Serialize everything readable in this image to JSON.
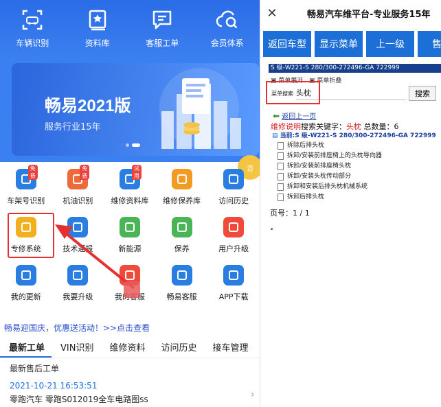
{
  "left": {
    "top_nav": [
      {
        "label": "车辆识别",
        "icon": "car-scan-icon"
      },
      {
        "label": "资料库",
        "icon": "book-icon"
      },
      {
        "label": "客服工单",
        "icon": "chat-icon"
      },
      {
        "label": "会员体系",
        "icon": "cloud-search-icon"
      }
    ],
    "banner": {
      "title": "畅易2021版",
      "subtitle": "服务行业15年"
    },
    "float_button": "咨",
    "grid_rows": [
      [
        {
          "label": "车架号识别",
          "icon": "vin-car-icon",
          "badge": "免费",
          "color": "#2a7de1"
        },
        {
          "label": "机油识别",
          "icon": "oil-icon",
          "badge": "免费",
          "color": "#ef6a3a"
        },
        {
          "label": "维修资料库",
          "icon": "repair-doc-icon",
          "badge": "试用",
          "color": "#2a7de1"
        },
        {
          "label": "维修保养库",
          "icon": "maintenance-icon",
          "badge": "",
          "color": "#f29a22"
        },
        {
          "label": "访问历史",
          "icon": "history-icon",
          "badge": "",
          "color": "#2a7de1"
        }
      ],
      [
        {
          "label": "专修系统",
          "icon": "clipboard-icon",
          "badge": "",
          "color": "#f2b01d"
        },
        {
          "label": "技术通报",
          "icon": "tech-bulletin-icon",
          "badge": "",
          "color": "#2a7de1"
        },
        {
          "label": "新能源",
          "icon": "leaf-icon",
          "badge": "",
          "color": "#4ab556"
        },
        {
          "label": "保养",
          "icon": "power-icon",
          "badge": "",
          "color": "#4ab556"
        },
        {
          "label": "用户升级",
          "icon": "upgrade-icon",
          "badge": "",
          "color": "#ef4a3a"
        }
      ],
      [
        {
          "label": "我的更新",
          "icon": "refresh-icon",
          "badge": "",
          "color": "#2a7de1"
        },
        {
          "label": "我要升级",
          "icon": "user-icon",
          "badge": "",
          "color": "#2a7de1"
        },
        {
          "label": "我的客服",
          "icon": "service-icon",
          "badge": "",
          "color": "#ef4a3a"
        },
        {
          "label": "畅易客服",
          "icon": "message-icon",
          "badge": "",
          "color": "#2a7de1"
        },
        {
          "label": "APP下载",
          "icon": "download-icon",
          "badge": "",
          "color": "#2a7de1"
        }
      ]
    ],
    "ticker": "畅易迎国庆，优惠送活动！>>点击查看",
    "tabs": [
      "最新工单",
      "VIN识别",
      "维修资料",
      "访问历史",
      "接车管理"
    ],
    "active_tab": 0,
    "subtitle": "最新售后工单",
    "record": {
      "date": "2021-10-21 16:53:51",
      "name": "零跑汽车 零跑S012019全车电路图ss"
    }
  },
  "right": {
    "title": "畅易汽车维平台-专业服务15年",
    "buttons": [
      "返回车型",
      "显示菜单",
      "上一级",
      "售后"
    ],
    "path": "S 级-W221-S 280/300-272496-GA 722999",
    "menu_expand": "菜单展开",
    "menu_collapse": "菜单折叠",
    "search_label": "菜单搜索",
    "search_value": "头枕",
    "search_button": "搜索",
    "back_link": "返回上一页",
    "stats": {
      "prefix": "维修说明",
      "mid": "搜索关键字：",
      "keyword": "头枕",
      "count_label": " 总数量：",
      "count": "6"
    },
    "current": "当前:S 级-W221-S 280/300-272496-GA 722999",
    "tree_items": [
      "拆除后排头枕",
      "拆卸/安装前排座椅上的头枕导向器",
      "拆卸/安装前排座椅头枕",
      "拆卸/安装头枕传动部分",
      "拆卸和安装后排头枕机械系统",
      "拆卸后排头枕"
    ],
    "pager": "页号：1 / 1"
  }
}
